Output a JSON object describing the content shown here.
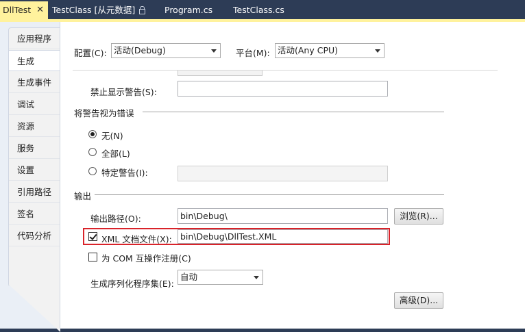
{
  "tabs": [
    {
      "label": "DllTest",
      "active": true
    },
    {
      "label": "TestClass [从元数据]"
    },
    {
      "label": "Program.cs"
    },
    {
      "label": "TestClass.cs"
    }
  ],
  "sidebar": {
    "items": [
      "应用程序",
      "生成",
      "生成事件",
      "调试",
      "资源",
      "服务",
      "设置",
      "引用路径",
      "签名",
      "代码分析"
    ],
    "selected": "生成"
  },
  "config": {
    "config_label": "配置(C):",
    "config_value": "活动(Debug)",
    "platform_label": "平台(M):",
    "platform_value": "活动(Any CPU)"
  },
  "warnings": {
    "suppress_label": "禁止显示警告(S):",
    "suppress_value": "",
    "treat_header": "将警告视为错误",
    "options": [
      "无(N)",
      "全部(L)",
      "特定警告(I):"
    ],
    "selected": "无(N)",
    "specific_value": ""
  },
  "output": {
    "header": "输出",
    "path_label": "输出路径(O):",
    "path_value": "bin\\Debug\\",
    "browse_label": "浏览(R)...",
    "xml_label": "XML 文档文件(X):",
    "xml_checked": true,
    "xml_value": "bin\\Debug\\DllTest.XML",
    "com_label": "为 COM 互操作注册(C)",
    "com_checked": false,
    "serialization_label": "生成序列化程序集(E):",
    "serialization_value": "自动",
    "advanced_label": "高级(D)..."
  },
  "colors": {
    "tab_bar": "#2d3c56",
    "active_tab": "#fff29d",
    "highlight": "#d9232a"
  }
}
